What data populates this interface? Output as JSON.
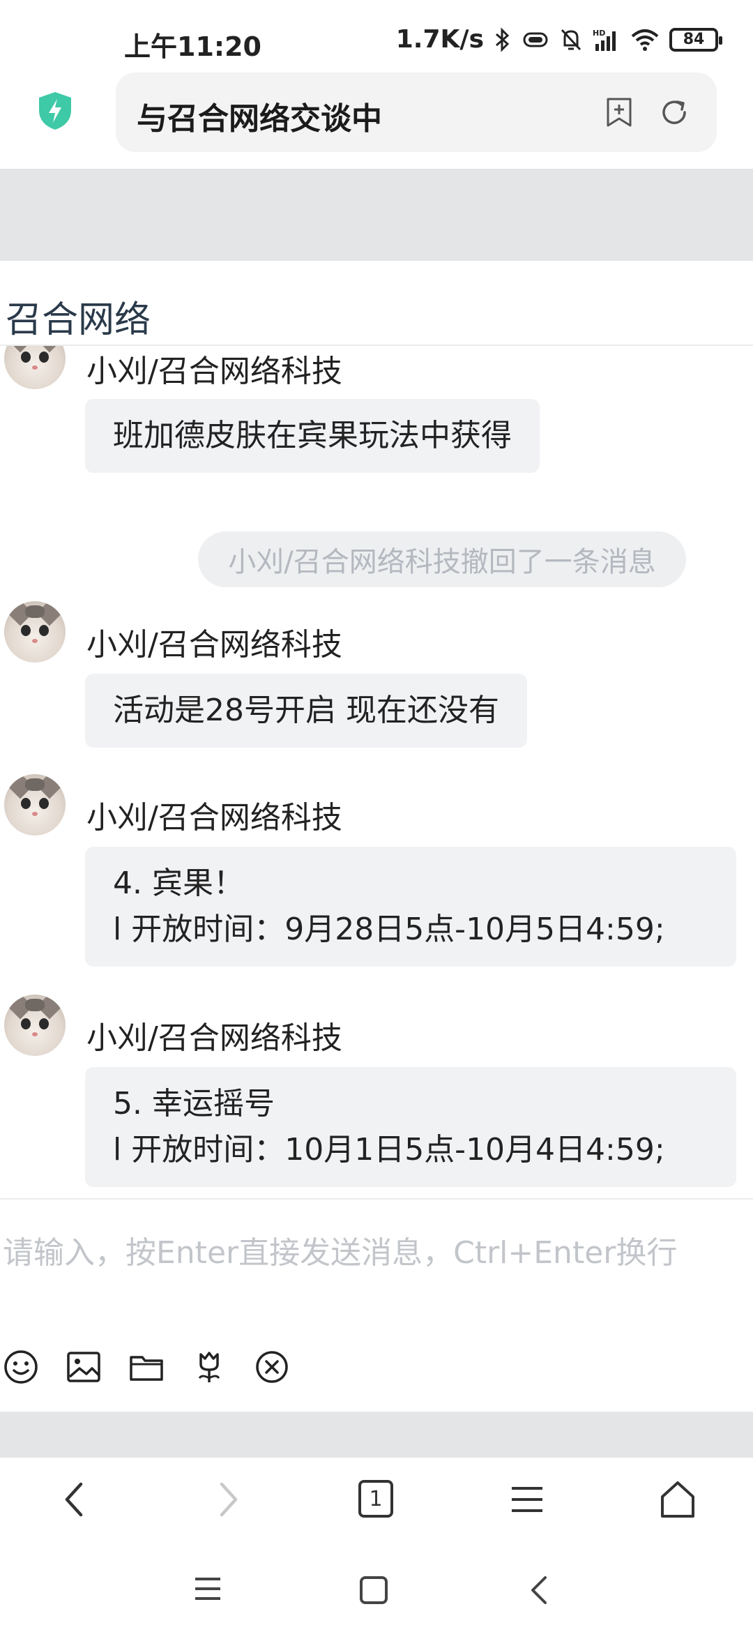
{
  "status": {
    "time": "上午11:20",
    "speed": "1.7K/s",
    "battery": "84"
  },
  "browser": {
    "page_title": "与召合网络交谈中"
  },
  "chat": {
    "title": "召合网络",
    "recall_notice": "小刈/召合网络科技撤回了一条消息",
    "messages": [
      {
        "sender": "小刈/召合网络科技",
        "lines": [
          "班加德皮肤在宾果玩法中获得"
        ]
      },
      {
        "sender": "小刈/召合网络科技",
        "lines": [
          "活动是28号开启  现在还没有"
        ]
      },
      {
        "sender": "小刈/召合网络科技",
        "lines": [
          "4. 宾果！",
          "l 开放时间：9月28日5点-10月5日4:59;"
        ]
      },
      {
        "sender": "小刈/召合网络科技",
        "lines": [
          "5. 幸运摇号",
          "l 开放时间：10月1日5点-10月4日4:59;"
        ]
      }
    ]
  },
  "input": {
    "placeholder": "请输入，按Enter直接发送消息，Ctrl+Enter换行"
  },
  "toolbar": {
    "icons": [
      "emoji-icon",
      "image-icon",
      "folder-icon",
      "flower-icon",
      "close-circle-icon"
    ]
  },
  "browser_nav": {
    "tab_count": "1"
  },
  "colors": {
    "shield": "#3ec9a7",
    "bubble_bg": "#f1f2f4",
    "band_gray": "#e4e5e6",
    "placeholder": "#c2c5ca"
  }
}
